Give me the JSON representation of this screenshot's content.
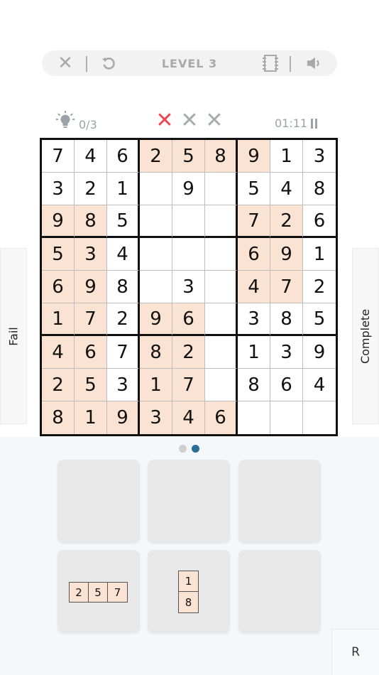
{
  "topbar": {
    "level_label": "LEVEL 3",
    "separator": "|",
    "icons": [
      "close-icon",
      "restart-icon",
      "notes-icon",
      "sound-icon"
    ]
  },
  "status": {
    "hint_count": "0/3",
    "mistakes": [
      {
        "glyph": "✕",
        "color": "#ef4550"
      },
      {
        "glyph": "✕",
        "color": "#a8abae"
      },
      {
        "glyph": "✕",
        "color": "#a8abae"
      }
    ],
    "timer": "01:11"
  },
  "board": {
    "highlight_color": "#fbe3d3",
    "rows": [
      [
        "7",
        "4",
        "6",
        "2",
        "5",
        "8",
        "9",
        "1",
        "3"
      ],
      [
        "3",
        "2",
        "1",
        "",
        "9",
        "",
        "5",
        "4",
        "8"
      ],
      [
        "9",
        "8",
        "5",
        "",
        "",
        "",
        "7",
        "2",
        "6"
      ],
      [
        "5",
        "3",
        "4",
        "",
        "",
        "",
        "6",
        "9",
        "1"
      ],
      [
        "6",
        "9",
        "8",
        "",
        "3",
        "",
        "4",
        "7",
        "2"
      ],
      [
        "1",
        "7",
        "2",
        "9",
        "6",
        "",
        "3",
        "8",
        "5"
      ],
      [
        "4",
        "6",
        "7",
        "8",
        "2",
        "",
        "1",
        "3",
        "9"
      ],
      [
        "2",
        "5",
        "3",
        "1",
        "7",
        "",
        "8",
        "6",
        "4"
      ],
      [
        "8",
        "1",
        "9",
        "3",
        "4",
        "6",
        "",
        "",
        ""
      ]
    ],
    "highlighted": [
      [
        0,
        3
      ],
      [
        0,
        4
      ],
      [
        0,
        5
      ],
      [
        0,
        6
      ],
      [
        2,
        0
      ],
      [
        2,
        1
      ],
      [
        2,
        6
      ],
      [
        2,
        7
      ],
      [
        3,
        0
      ],
      [
        3,
        1
      ],
      [
        3,
        6
      ],
      [
        3,
        7
      ],
      [
        4,
        0
      ],
      [
        4,
        1
      ],
      [
        4,
        6
      ],
      [
        4,
        7
      ],
      [
        5,
        0
      ],
      [
        5,
        1
      ],
      [
        5,
        3
      ],
      [
        5,
        4
      ],
      [
        6,
        0
      ],
      [
        6,
        1
      ],
      [
        6,
        3
      ],
      [
        6,
        4
      ],
      [
        7,
        0
      ],
      [
        7,
        1
      ],
      [
        7,
        3
      ],
      [
        7,
        4
      ],
      [
        8,
        0
      ],
      [
        8,
        1
      ],
      [
        8,
        2
      ],
      [
        8,
        3
      ],
      [
        8,
        4
      ],
      [
        8,
        5
      ]
    ]
  },
  "side_buttons": {
    "fail": "Fail",
    "complete": "Complete"
  },
  "pager": {
    "active_color": "#2a6f97",
    "inactive_color": "#cfcfcf",
    "pages": 2,
    "active_index": 1
  },
  "pieces": {
    "horizontal": [
      "2",
      "5",
      "7"
    ],
    "vertical": [
      "1",
      "8"
    ]
  },
  "r_button": "R"
}
